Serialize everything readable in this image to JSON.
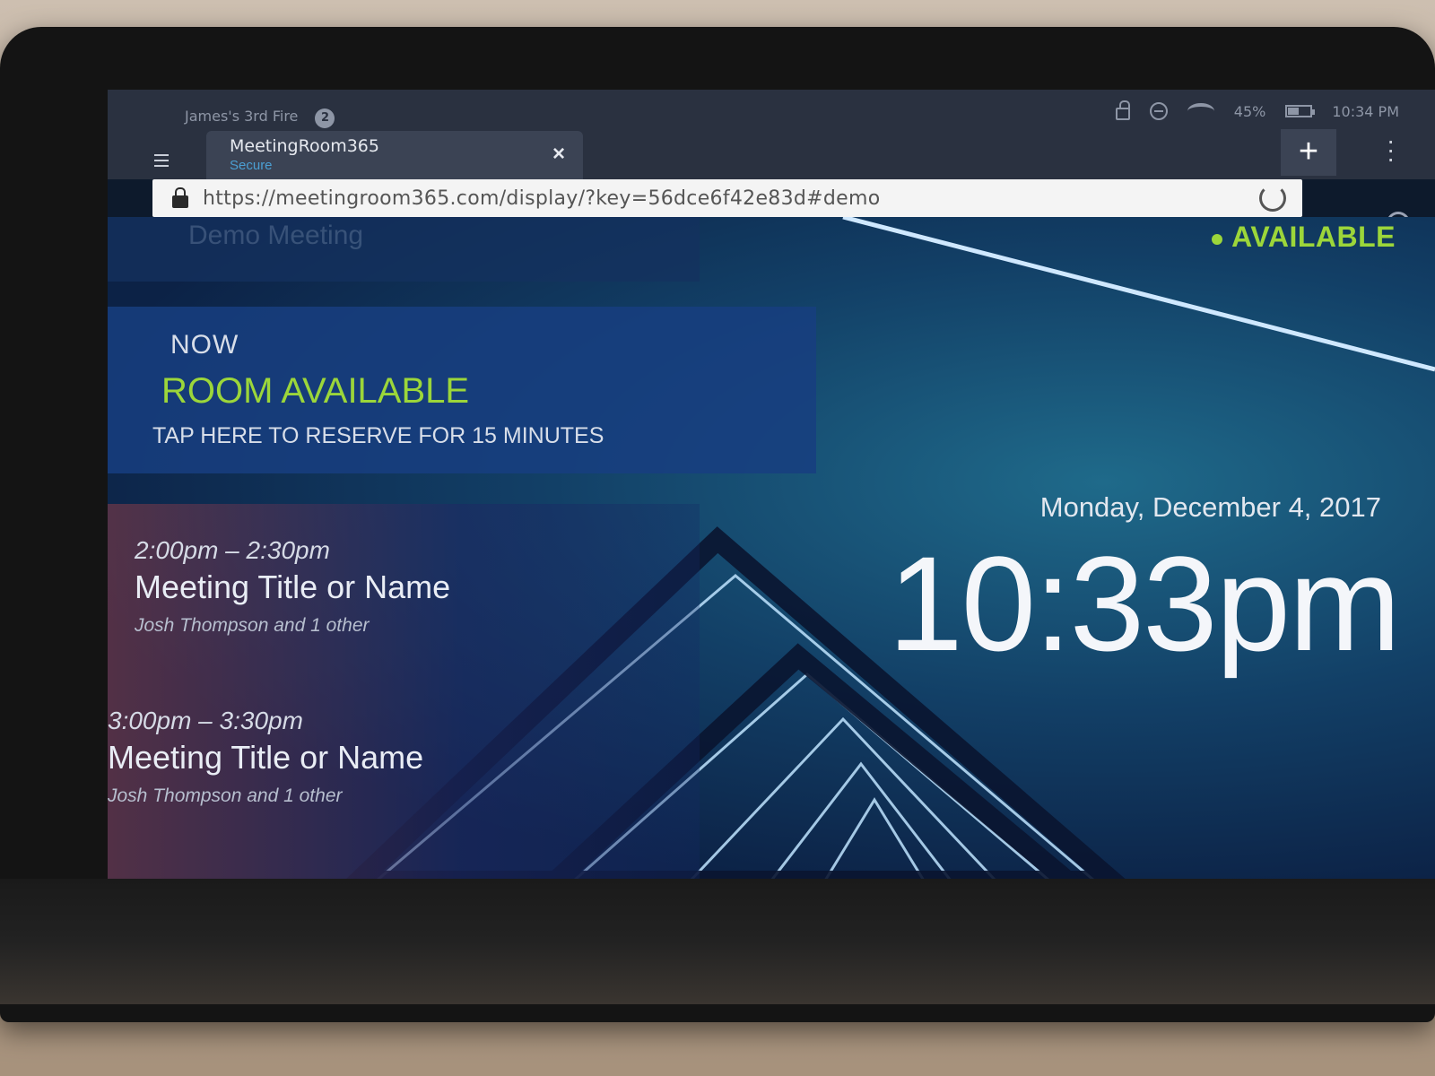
{
  "browser": {
    "profile_name": "James's 3rd Fire",
    "profile_badge": "2",
    "status_battery": "45%",
    "status_time": "10:34 PM",
    "tab": {
      "title": "MeetingRoom365",
      "subtitle": "Secure",
      "close": "×"
    },
    "new_tab": "+",
    "url": "https://meetingroom365.com/display/?key=56dce6f42e83d#demo"
  },
  "room": {
    "name": "Demo Meeting",
    "status": "AVAILABLE",
    "colors": {
      "available": "#9cd63a"
    }
  },
  "now": {
    "label": "NOW",
    "status": "ROOM AVAILABLE",
    "action": "TAP HERE TO RESERVE FOR 15 MINUTES"
  },
  "meetings": [
    {
      "time": "2:00pm – 2:30pm",
      "title": "Meeting Title or Name",
      "people": "Josh Thompson and 1 other"
    },
    {
      "time": "3:00pm – 3:30pm",
      "title": "Meeting Title or Name",
      "people": "Josh Thompson and 1 other"
    }
  ],
  "clock": {
    "date": "Monday, December 4, 2017",
    "time": "10:33pm"
  }
}
